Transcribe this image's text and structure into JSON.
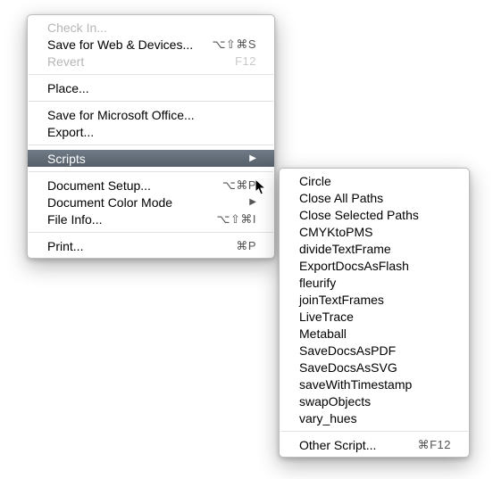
{
  "main_menu": {
    "items": [
      {
        "label": "Check In...",
        "shortcut": "",
        "disabled": true
      },
      {
        "label": "Save for Web & Devices...",
        "shortcut": "⌥⇧⌘S"
      },
      {
        "label": "Revert",
        "shortcut": "F12",
        "disabled": true
      },
      null,
      {
        "label": "Place..."
      },
      null,
      {
        "label": "Save for Microsoft Office..."
      },
      {
        "label": "Export..."
      },
      null,
      {
        "label": "Scripts",
        "submenu": true,
        "highlight": true
      },
      null,
      {
        "label": "Document Setup...",
        "shortcut": "⌥⌘P"
      },
      {
        "label": "Document Color Mode",
        "submenu": true
      },
      {
        "label": "File Info...",
        "shortcut": "⌥⇧⌘I"
      },
      null,
      {
        "label": "Print...",
        "shortcut": "⌘P"
      }
    ]
  },
  "sub_menu": {
    "items": [
      {
        "label": "Circle"
      },
      {
        "label": "Close All Paths"
      },
      {
        "label": "Close Selected Paths"
      },
      {
        "label": "CMYKtoPMS"
      },
      {
        "label": "divideTextFrame"
      },
      {
        "label": "ExportDocsAsFlash"
      },
      {
        "label": "fleurify"
      },
      {
        "label": "joinTextFrames"
      },
      {
        "label": "LiveTrace"
      },
      {
        "label": "Metaball"
      },
      {
        "label": "SaveDocsAsPDF"
      },
      {
        "label": "SaveDocsAsSVG"
      },
      {
        "label": "saveWithTimestamp"
      },
      {
        "label": "swapObjects"
      },
      {
        "label": "vary_hues"
      },
      null,
      {
        "label": "Other Script...",
        "shortcut": "⌘F12"
      }
    ]
  }
}
